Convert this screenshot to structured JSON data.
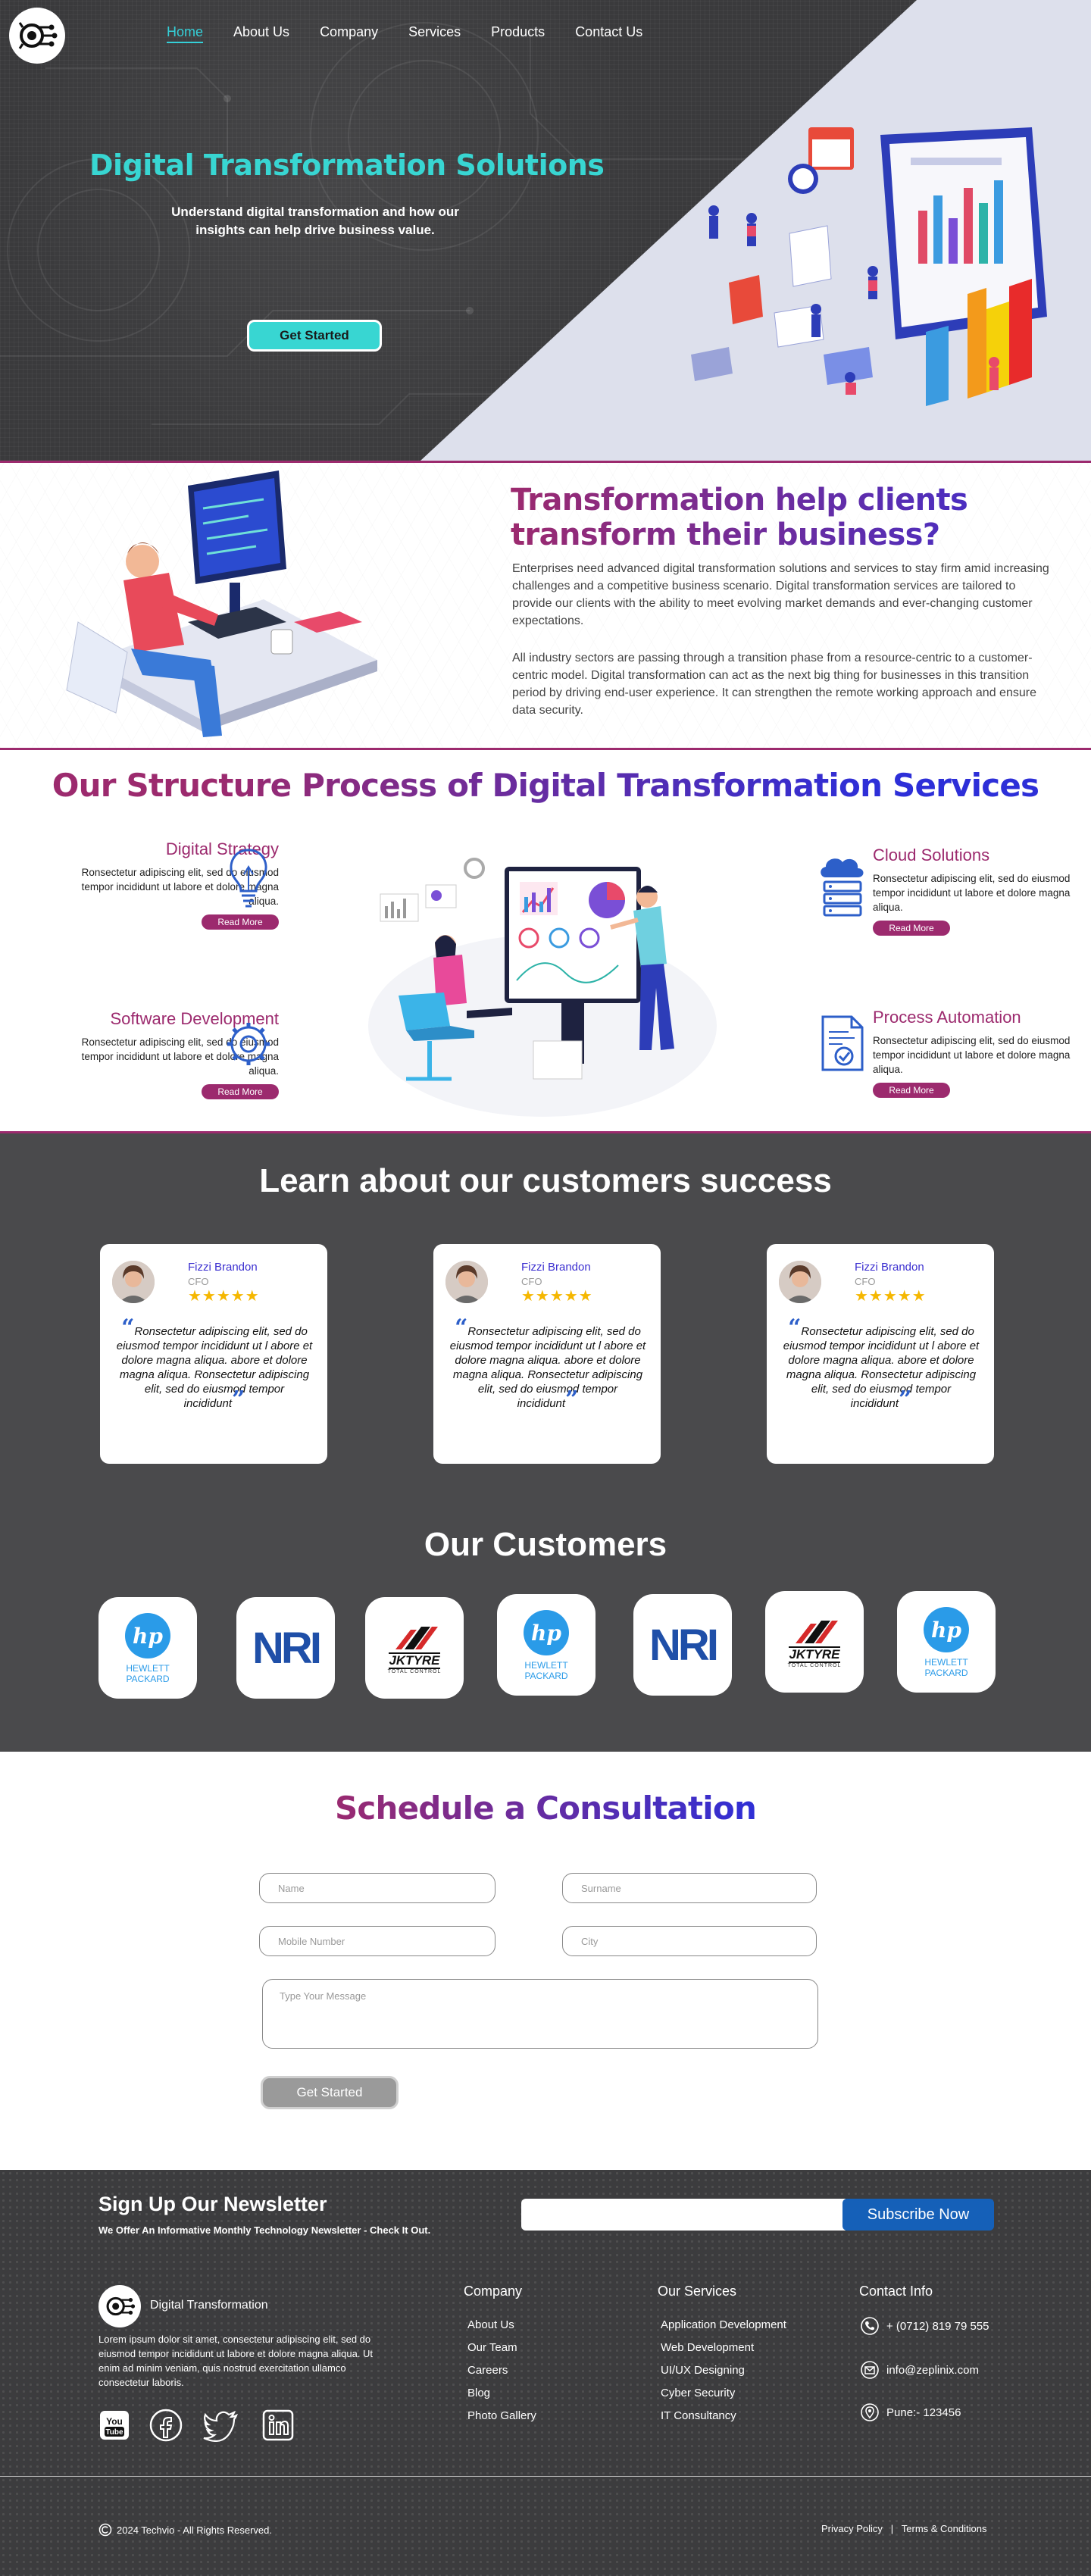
{
  "nav": {
    "items": [
      "Home",
      "About Us",
      "Company",
      "Services",
      "Products",
      "Contact Us"
    ]
  },
  "hero": {
    "title": "Digital Transformation Solutions",
    "subtitle": "Understand digital transformation and how our insights can help drive business value.",
    "cta": "Get Started"
  },
  "transform": {
    "title": "Transformation help clients transform their business?",
    "p1": "Enterprises need advanced digital transformation solutions and services to stay firm amid increasing challenges and a competitive business scenario. Digital transformation services are tailored to provide our clients with the ability to meet evolving market demands and ever-changing customer expectations.",
    "p2": "All industry sectors are passing through a transition phase from a resource-centric to a customer-centric model. Digital transformation can act as the next big thing for businesses in this transition period by driving end-user experience. It can strengthen the remote working approach and ensure data security."
  },
  "process": {
    "title": "Our Structure Process of Digital Transformation Services",
    "services": [
      {
        "title": "Digital Strategy",
        "desc": "Ronsectetur adipiscing elit, sed do eiusmod tempor incididunt ut labore et dolore magna aliqua.",
        "btn": "Read More",
        "icon": "lightbulb-icon"
      },
      {
        "title": "Cloud Solutions",
        "desc": "Ronsectetur adipiscing elit, sed do eiusmod tempor incididunt ut labore et dolore magna aliqua.",
        "btn": "Read More",
        "icon": "cloud-server-icon"
      },
      {
        "title": "Software Development",
        "desc": "Ronsectetur adipiscing elit, sed do eiusmod tempor incididunt ut labore et dolore magna aliqua.",
        "btn": "Read More",
        "icon": "gear-icon"
      },
      {
        "title": "Process Automation",
        "desc": "Ronsectetur adipiscing elit, sed do eiusmod tempor incididunt ut labore et dolore magna aliqua.",
        "btn": "Read More",
        "icon": "document-check-icon"
      }
    ]
  },
  "success": {
    "title": "Learn about our customers success",
    "testimonials": [
      {
        "name": "Fizzi Brandon",
        "role": "CFO",
        "stars": "★★★★★",
        "rating": 5,
        "quote": "Ronsectetur adipiscing elit, sed do eiusmod tempor incididunt ut l abore et dolore magna aliqua. abore et dolore magna aliqua. Ronsectetur adipiscing elit, sed do eiusmod tempor incididunt"
      },
      {
        "name": "Fizzi Brandon",
        "role": "CFO",
        "stars": "★★★★★",
        "rating": 5,
        "quote": "Ronsectetur adipiscing elit, sed do eiusmod tempor incididunt ut l abore et dolore magna aliqua. abore et dolore magna aliqua. Ronsectetur adipiscing elit, sed do eiusmod tempor incididunt"
      },
      {
        "name": "Fizzi Brandon",
        "role": "CFO",
        "stars": "★★★★★",
        "rating": 5,
        "quote": "Ronsectetur adipiscing elit, sed do eiusmod tempor incididunt ut l abore et dolore magna aliqua. abore et dolore magna aliqua. Ronsectetur adipiscing elit, sed do eiusmod tempor incididunt"
      }
    ]
  },
  "customers": {
    "title": "Our Customers",
    "logos": [
      {
        "name": "hp",
        "line1": "HEWLETT",
        "line2": "PACKARD"
      },
      {
        "name": "nri",
        "text": "NRI"
      },
      {
        "name": "jktyre",
        "text": "JKTYRE",
        "tag": "TOTAL CONTROL"
      },
      {
        "name": "hp",
        "line1": "HEWLETT",
        "line2": "PACKARD"
      },
      {
        "name": "nri",
        "text": "NRI"
      },
      {
        "name": "jktyre",
        "text": "JKTYRE",
        "tag": "TOTAL CONTROL"
      },
      {
        "name": "hp",
        "line1": "HEWLETT",
        "line2": "PACKARD"
      }
    ]
  },
  "schedule": {
    "title": "Schedule a Consultation",
    "name_ph": "Name",
    "surname_ph": "Surname",
    "mobile_ph": "Mobile Number",
    "city_ph": "City",
    "message_ph": "Type Your Message",
    "btn": "Get Started"
  },
  "footer": {
    "nl_title": "Sign Up Our Newsletter",
    "nl_sub": "We Offer An Informative Monthly Technology Newsletter - Check It Out.",
    "nl_btn": "Subscribe Now",
    "brand": "Digital Transformation",
    "about": "Lorem ipsum dolor sit amet, consectetur adipiscing elit, sed do eiusmod tempor incididunt ut labore et dolore magna aliqua. Ut enim ad minim veniam, quis nostrud exercitation ullamco consectetur laboris.",
    "company_h": "Company",
    "company": [
      "About Us",
      "Our Team",
      "Careers",
      "Blog",
      "Photo Gallery"
    ],
    "services_h": "Our Services",
    "services": [
      "Application Development",
      "Web Development",
      "UI/UX Designing",
      "Cyber Security",
      "IT Consultancy"
    ],
    "contact_h": "Contact Info",
    "phone": "+ (0712) 819 79 555",
    "email": "info@zeplinix.com",
    "location": "Pune:- 123456",
    "copyright": "2024 Techvio - All Rights Reserved.",
    "privacy": "Privacy Policy",
    "sep": "|",
    "terms": "Terms & Conditions"
  },
  "colors": {
    "accent_teal": "#38d6d2",
    "brand_magenta": "#9c2a6e",
    "brand_blue": "#3b2fd0",
    "dark_bg": "#4a4a4c",
    "subscribe_blue": "#1560b8"
  }
}
